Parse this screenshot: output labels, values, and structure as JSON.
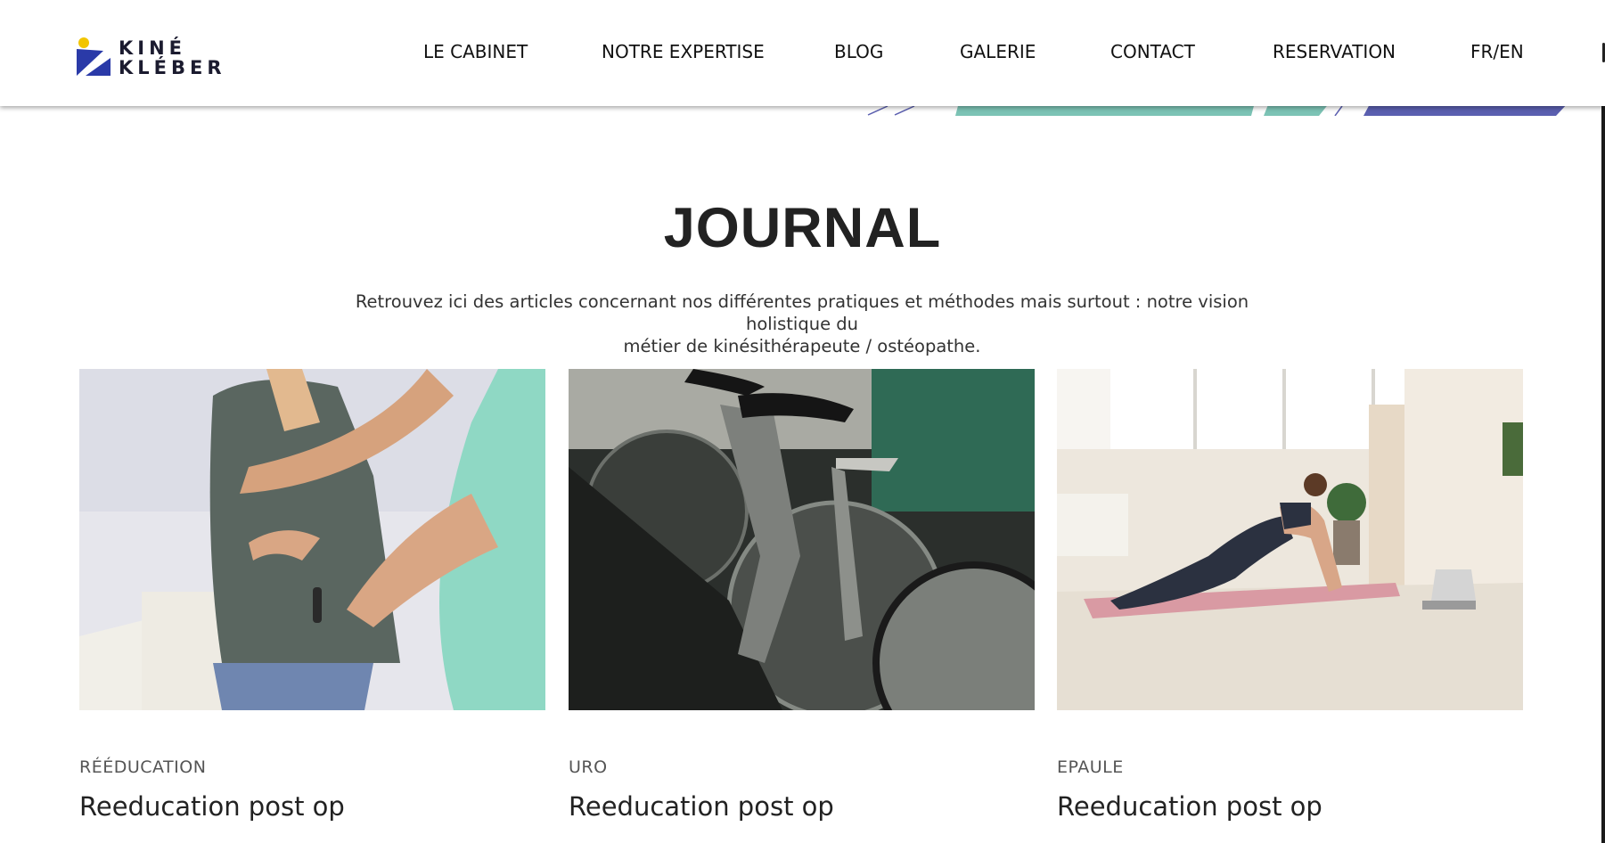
{
  "brand": {
    "logo_line1": "KINÉ",
    "logo_line2": "KLÉBER"
  },
  "nav": {
    "items": [
      {
        "label": "LE CABINET"
      },
      {
        "label": "NOTRE EXPERTISE"
      },
      {
        "label": "BLOG"
      },
      {
        "label": "GALERIE"
      },
      {
        "label": "CONTACT"
      },
      {
        "label": "RESERVATION"
      },
      {
        "label": "FR/EN"
      }
    ]
  },
  "journal": {
    "title": "JOURNAL",
    "intro_line1": "Retrouvez ici des articles concernant nos différentes pratiques et méthodes mais surtout : notre vision holistique du",
    "intro_line2": "métier de kinésithérapeute / ostéopathe."
  },
  "articles": [
    {
      "category": "RÉÉDUCATION",
      "title": "Reeducation post op",
      "image": "physiotherapy-back-photo"
    },
    {
      "category": "URO",
      "title": "Reeducation post op",
      "image": "exercise-bikes-photo"
    },
    {
      "category": "EPAULE",
      "title": "Reeducation post op",
      "image": "yoga-mat-exercise-photo"
    }
  ],
  "colors": {
    "brand_blue": "#2a3aa8",
    "brand_yellow": "#f2c500",
    "accent_teal": "#7cc3b5",
    "accent_indigo": "#5b5fb0",
    "text_dark": "#222222"
  }
}
